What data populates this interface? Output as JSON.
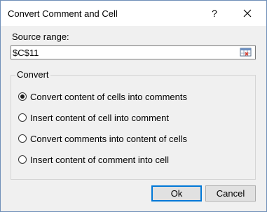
{
  "window": {
    "title": "Convert Comment and Cell",
    "help_label": "?",
    "close_icon": "close-icon"
  },
  "source": {
    "label": "Source range:",
    "value": "$C$11",
    "picker_icon": "range-select-icon"
  },
  "convert": {
    "legend": "Convert",
    "options": [
      {
        "label": "Convert content of cells into comments",
        "checked": true
      },
      {
        "label": "Insert content of cell into comment",
        "checked": false
      },
      {
        "label": "Convert comments into content of cells",
        "checked": false
      },
      {
        "label": "Insert content of comment into cell",
        "checked": false
      }
    ]
  },
  "buttons": {
    "ok": "Ok",
    "cancel": "Cancel"
  }
}
